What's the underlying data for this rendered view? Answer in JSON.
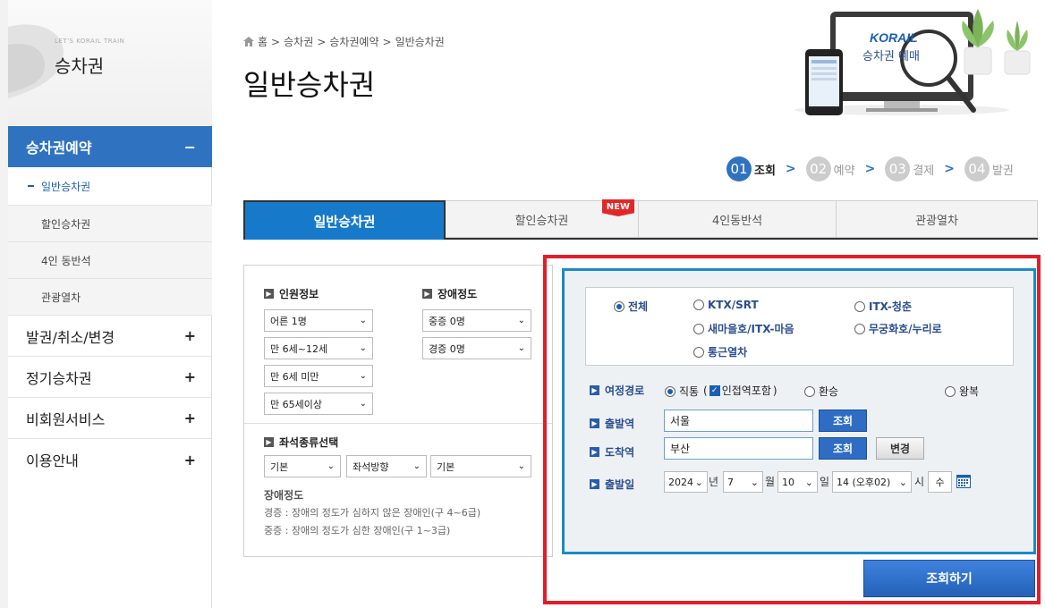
{
  "sidebar": {
    "eyebrow": "LET'S KORAIL TRAIN",
    "title": "승차권",
    "active_menu": {
      "label": "승차권예약",
      "toggle": "−"
    },
    "sub_items": [
      {
        "label": "일반승차권",
        "active": true
      },
      {
        "label": "할인승차권",
        "active": false
      },
      {
        "label": "4인 동반석",
        "active": false
      },
      {
        "label": "관광열차",
        "active": false
      }
    ],
    "menus": [
      {
        "label": "발권/취소/변경",
        "toggle": "+"
      },
      {
        "label": "정기승차권",
        "toggle": "+"
      },
      {
        "label": "비회원서비스",
        "toggle": "+"
      },
      {
        "label": "이용안내",
        "toggle": "+"
      }
    ]
  },
  "header": {
    "breadcrumb": [
      "홈",
      "승차권",
      "승차권예약",
      "일반승차권"
    ],
    "breadcrumb_sep": ">",
    "title": "일반승차권",
    "banner_logo": "KORAIL",
    "banner_text": "승차권 예매"
  },
  "steps": [
    {
      "num": "01",
      "label": "조회",
      "active": true
    },
    {
      "num": "02",
      "label": "예약",
      "active": false
    },
    {
      "num": "03",
      "label": "결제",
      "active": false
    },
    {
      "num": "04",
      "label": "발권",
      "active": false
    }
  ],
  "step_arrow": ">",
  "tabs": [
    {
      "label": "일반승차권",
      "active": true
    },
    {
      "label": "할인승차권",
      "badge": "NEW"
    },
    {
      "label": "4인동반석"
    },
    {
      "label": "관광열차"
    }
  ],
  "passengers": {
    "title": "인원정보",
    "selects": [
      "어른 1명",
      "만 6세~12세",
      "만 6세 미만",
      "만 65세이상"
    ]
  },
  "disability": {
    "title": "장애정도",
    "selects": [
      "중증 0명",
      "경증 0명"
    ]
  },
  "seat": {
    "title": "좌석종류선택",
    "selects": [
      "기본",
      "좌석방향",
      "기본"
    ]
  },
  "notes": {
    "title": "장애정도",
    "line1": "경증 : 장애의 정도가 심하지 않은 장애인(구 4~6급)",
    "line2": "중증 : 장애의 정도가 심한 장애인(구 1~3급)"
  },
  "train_types": [
    {
      "label": "전체",
      "checked": true
    },
    {
      "label": "KTX/SRT",
      "checked": false
    },
    {
      "label": "ITX-청춘",
      "checked": false
    },
    {
      "label": "새마을호/ITX-마음",
      "checked": false
    },
    {
      "label": "무궁화호/누리로",
      "checked": false
    },
    {
      "label": "통근열차",
      "checked": false
    }
  ],
  "route": {
    "label": "여정경로",
    "direct": "직통",
    "transfer_include": "인접역포함",
    "transfer": "환승",
    "round": "왕복"
  },
  "departure": {
    "label": "출발역",
    "value": "서울",
    "button": "조회"
  },
  "arrival": {
    "label": "도착역",
    "value": "부산",
    "button": "조회",
    "swap": "변경"
  },
  "date": {
    "label": "출발일",
    "year": "2024",
    "year_unit": "년",
    "month": "7",
    "month_unit": "월",
    "day": "10",
    "day_unit": "일",
    "hour": "14 (오후02)",
    "hour_unit": "시",
    "weekday": "수"
  },
  "search_button": "조회하기",
  "colors": {
    "accent": "#2f73c0",
    "tab_active": "#1679c9",
    "highlight": "#e01e2a"
  }
}
